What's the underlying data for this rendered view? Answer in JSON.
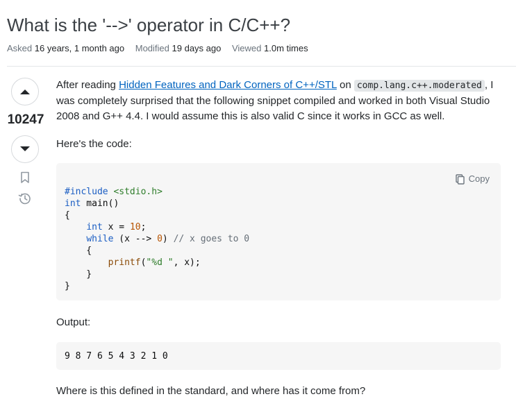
{
  "question": {
    "title": "What is the '-->' operator in C/C++?",
    "meta": {
      "asked_label": "Asked",
      "asked_value": "16 years, 1 month ago",
      "modified_label": "Modified",
      "modified_value": "19 days ago",
      "viewed_label": "Viewed",
      "viewed_value": "1.0m times"
    },
    "score": "10247"
  },
  "icons": {
    "upvote": "arrow-up-icon",
    "downvote": "arrow-down-icon",
    "bookmark": "bookmark-icon",
    "history": "history-icon",
    "copy": "copy-icon"
  },
  "colors": {
    "link": "#0063bf",
    "code_bg": "#f6f6f6",
    "keyword": "#1a5dc3",
    "string": "#2f7d2b",
    "number": "#b75301"
  },
  "post": {
    "para1_before": "After reading ",
    "para1_link": "Hidden Features and Dark Corners of C++/STL",
    "para1_on": " on ",
    "para1_code": "comp.lang.c++.moderated",
    "para1_after": ", I was completely surprised that the following snippet compiled and worked in both Visual Studio 2008 and G++ 4.4. I would assume this is also valid C since it works in GCC as well.",
    "para2": "Here's the code:",
    "copy_label": "Copy",
    "code": {
      "include_kw": "#include",
      "include_hdr": " <stdio.h>",
      "main_type": "int",
      "main_rest": " main()",
      "open_brace": "{",
      "decl_indent": "    ",
      "decl_type": "int",
      "decl_rest": " x = ",
      "decl_val": "10",
      "decl_end": ";",
      "while_kw": "while",
      "while_mid": " (x --> ",
      "while_num": "0",
      "while_close": ") ",
      "while_comment": "// x goes to 0",
      "inner_open": "    {",
      "printf_indent": "        ",
      "printf_fn": "printf",
      "printf_open": "(",
      "printf_str": "\"%d \"",
      "printf_rest": ", x);",
      "inner_close": "    }",
      "close_brace": "}"
    },
    "para3": "Output:",
    "output": "9 8 7 6 5 4 3 2 1 0",
    "para4": "Where is this defined in the standard, and where has it come from?"
  }
}
